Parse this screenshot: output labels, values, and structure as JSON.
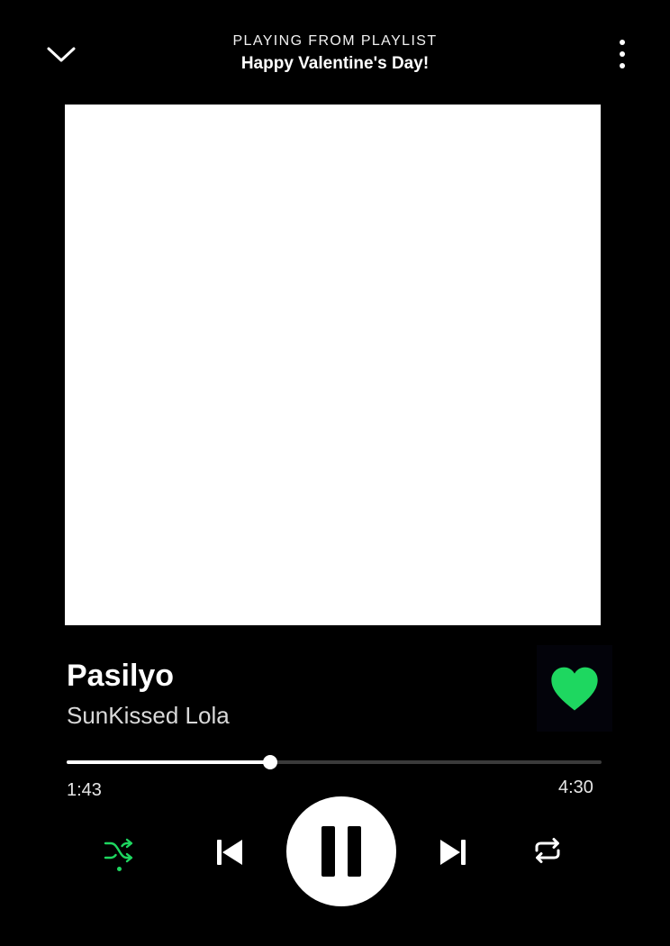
{
  "header": {
    "context_label": "PLAYING FROM PLAYLIST",
    "playlist_name": "Happy Valentine's Day!",
    "collapse_icon": "chevron-down-icon",
    "more_icon": "more-vertical-icon"
  },
  "artwork": {
    "color": "#ffffff"
  },
  "track": {
    "title": "Pasilyo",
    "artist": "SunKissed Lola",
    "liked": true
  },
  "playback": {
    "elapsed": "1:43",
    "duration": "4:30",
    "progress_fraction": 0.38,
    "is_playing": true,
    "shuffle_on": true,
    "repeat_on": false
  },
  "controls": {
    "shuffle_icon": "shuffle-icon",
    "previous_icon": "skip-previous-icon",
    "play_pause_icon": "pause-icon",
    "next_icon": "skip-next-icon",
    "repeat_icon": "repeat-icon"
  },
  "colors": {
    "background": "#000000",
    "accent": "#1ed760",
    "text": "#ffffff"
  }
}
